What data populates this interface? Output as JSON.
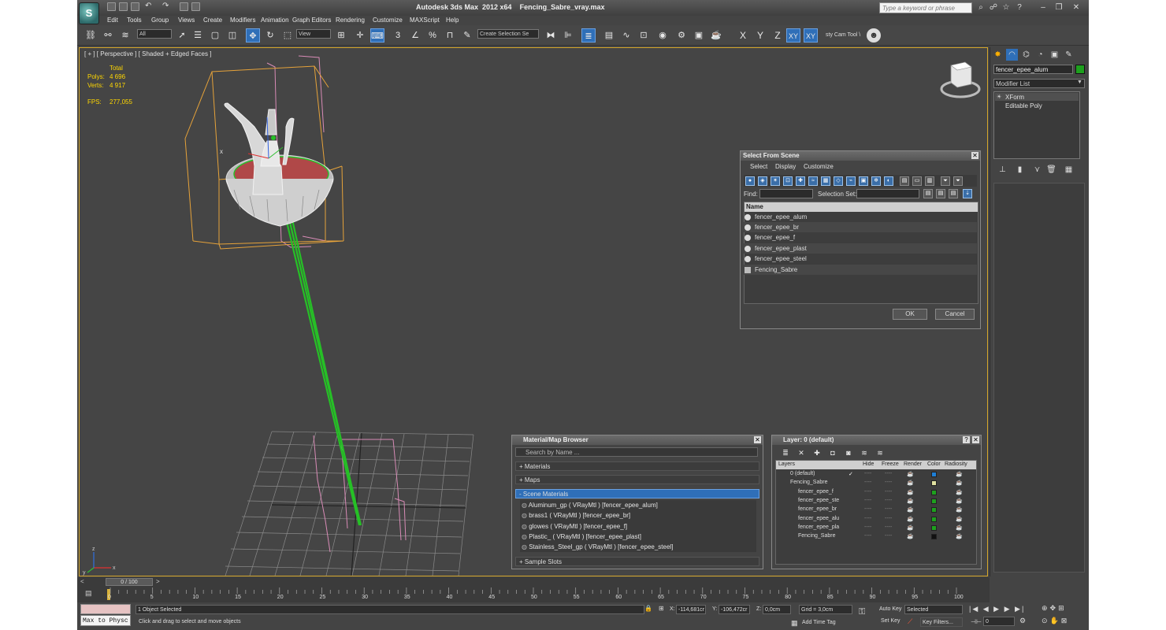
{
  "title": {
    "app": "Autodesk 3ds Max  2012 x64",
    "file": "Fencing_Sabre_vray.max",
    "search_placeholder": "Type a keyword or phrase",
    "logo": "S"
  },
  "menu": [
    "Edit",
    "Tools",
    "Group",
    "Views",
    "Create",
    "Modifiers",
    "Animation",
    "Graph Editors",
    "Rendering",
    "Customize",
    "MAXScript",
    "Help"
  ],
  "toolbar": {
    "selection_filter": "All",
    "reference_coord": "View",
    "snap_label": "3",
    "angle_snap": "∠",
    "percent_snap": "%",
    "named_set_placeholder": "Create Selection Se",
    "axis": [
      "X",
      "Y",
      "Z",
      "XY",
      "XY"
    ],
    "custom_tool": "sty Cam Tool \\"
  },
  "viewport": {
    "label": "[ + ] [ Perspective ] [ Shaded + Edged Faces ]",
    "stats": {
      "total_label": "Total",
      "polys_label": "Polys:",
      "polys": "4 696",
      "verts_label": "Verts:",
      "verts": "4 917",
      "fps_label": "FPS:",
      "fps": "277,055"
    },
    "axis_labels": {
      "x": "x",
      "y": "y",
      "z": "z"
    }
  },
  "command_panel": {
    "object_name": "fencer_epee_alum",
    "object_color": "#1ea01e",
    "modifier_list": "Modifier List",
    "stack": [
      "XForm",
      "Editable Poly"
    ]
  },
  "select_from_scene": {
    "title": "Select From Scene",
    "menus": [
      "Select",
      "Display",
      "Customize"
    ],
    "find_label": "Find:",
    "selection_set_label": "Selection Set:",
    "column_name": "Name",
    "objects": [
      "fencer_epee_alum",
      "fencer_epee_br",
      "fencer_epee_f",
      "fencer_epee_plast",
      "fencer_epee_steel",
      "Fencing_Sabre"
    ],
    "ok": "OK",
    "cancel": "Cancel"
  },
  "material_browser": {
    "title": "Material/Map Browser",
    "search_placeholder": "Search by Name ...",
    "sections": [
      "+ Materials",
      "+ Maps",
      "- Scene Materials"
    ],
    "scene_materials": [
      "Aluminum_gp  ( VRayMtl ) [fencer_epee_alum]",
      "brass1  ( VRayMtl ) [fencer_epee_br]",
      "glowes  ( VRayMtl ) [fencer_epee_f]",
      "Plastic_  ( VRayMtl ) [fencer_epee_plast]",
      "Stainless_Steel_gp  ( VRayMtl ) [fencer_epee_steel]"
    ],
    "sample_slots": "+ Sample Slots"
  },
  "layer_dialog": {
    "title": "Layer: 0 (default)",
    "help": "?",
    "columns": [
      "Layers",
      "Hide",
      "Freeze",
      "Render",
      "Color",
      "Radiosity"
    ],
    "rows": [
      {
        "name": "0 (default)",
        "color": "#1e7fd6",
        "check": "✓"
      },
      {
        "name": "Fencing_Sabre",
        "color": "#e0e0a0",
        "check": ""
      },
      {
        "name": "fencer_epee_f",
        "color": "#1ea01e",
        "check": ""
      },
      {
        "name": "fencer_epee_ste",
        "color": "#1ea01e",
        "check": ""
      },
      {
        "name": "fencer_epee_br",
        "color": "#1ea01e",
        "check": ""
      },
      {
        "name": "fencer_epee_alu",
        "color": "#1ea01e",
        "check": ""
      },
      {
        "name": "fencer_epee_pla",
        "color": "#1ea01e",
        "check": ""
      },
      {
        "name": "Fencing_Sabre",
        "color": "#111111",
        "check": ""
      }
    ],
    "dash": "----"
  },
  "timeline": {
    "current": "0 / 100",
    "ticks": [
      "0",
      "5",
      "10",
      "15",
      "20",
      "25",
      "30",
      "35",
      "40",
      "45",
      "50",
      "55",
      "60",
      "65",
      "70",
      "75",
      "80",
      "85",
      "90",
      "95",
      "100"
    ]
  },
  "status": {
    "maxscript": "Max to Physc",
    "selected": "1 Object Selected",
    "prompt": "Click and drag to select and move objects",
    "x_label": "X:",
    "x": "-114,681cr",
    "y_label": "Y:",
    "y": "-106,472cr",
    "z_label": "Z:",
    "z": "0,0cm",
    "grid": "Grid = 3,0cm",
    "add_time_tag": "Add Time Tag",
    "auto_key": "Auto Key",
    "set_key": "Set Key",
    "key_mode": "Selected",
    "key_filters": "Key Filters...",
    "frame": "0"
  }
}
